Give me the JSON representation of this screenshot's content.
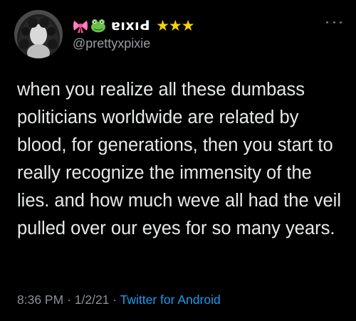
{
  "user": {
    "display_name": "ɐıxıԀ",
    "handle": "@prettyxpixie",
    "name_emojis": [
      "bow-emoji",
      "frog-emoji"
    ],
    "stars": "★★★"
  },
  "tweet": {
    "text": "when you realize all these dumbass politicians worldwide are related by blood, for generations, then you start to really recognize the immensity of the lies. and how much weve all had the veil pulled over our eyes for so many years."
  },
  "meta": {
    "time": "8:36 PM",
    "date": "1/2/21",
    "sep": " · ",
    "source": "Twitter for Android"
  },
  "colors": {
    "background": "#000000",
    "text": "#e7e9ea",
    "secondary": "#8b8f94",
    "link": "#1d9bf0",
    "stars": "#f5d10a"
  }
}
